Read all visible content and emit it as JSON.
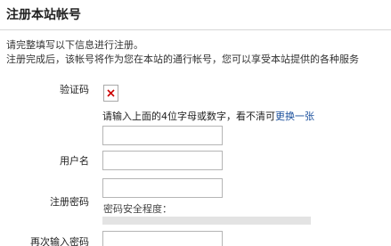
{
  "header": {
    "title": "注册本站帐号"
  },
  "intro": {
    "line1": "请完整填写以下信息进行注册。",
    "line2": "注册完成后，该帐号将作为您在本站的通行帐号，您可以享受本站提供的各种服务"
  },
  "form": {
    "captcha": {
      "label": "验证码",
      "hint": "请输入上面的4位字母或数字，看不清可",
      "refresh_link": "更换一张",
      "value": ""
    },
    "username": {
      "label": "用户名",
      "value": ""
    },
    "password": {
      "label": "注册密码",
      "value": "",
      "strength_label": "密码安全程度：",
      "strength_level": 0
    },
    "confirm_password": {
      "label": "再次输入密码",
      "value": ""
    }
  },
  "icons": {
    "captcha_image": "broken-image-icon"
  },
  "colors": {
    "link": "#1a4f9c",
    "strength_track": "#e3e3e3",
    "captcha_broken_x": "#cc0000"
  }
}
